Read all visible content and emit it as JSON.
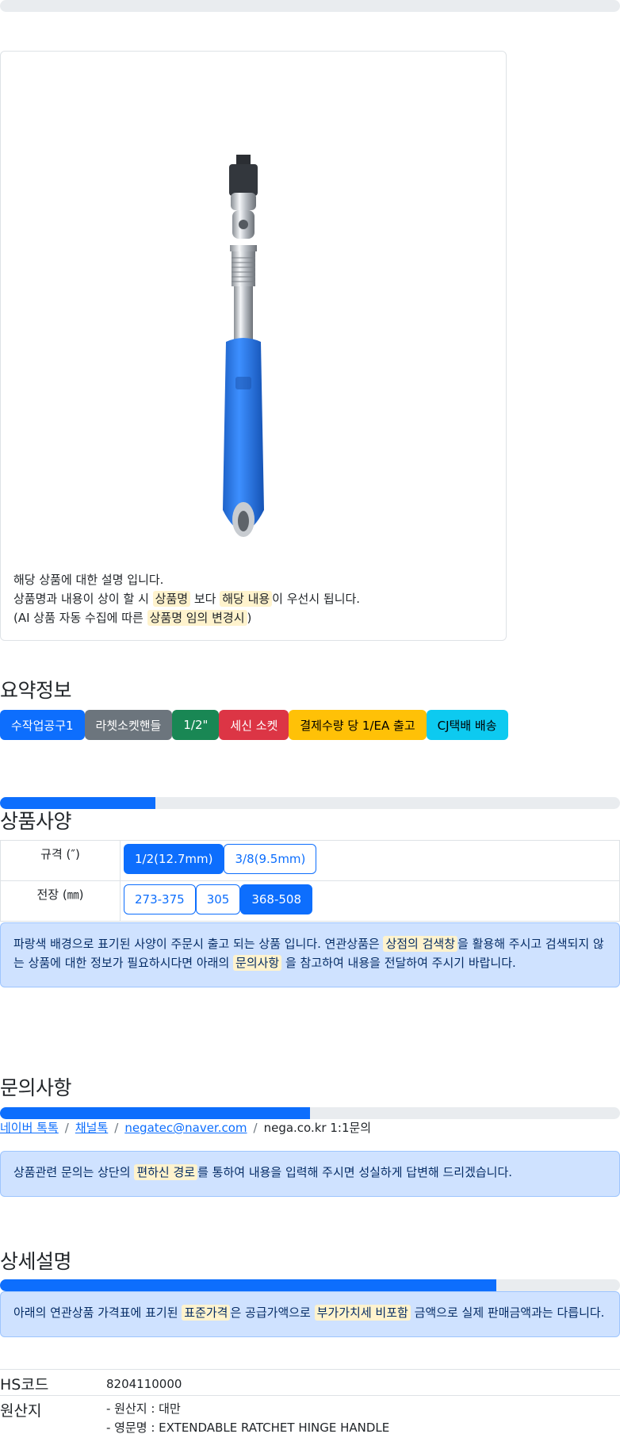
{
  "top_progress": {
    "value": 0
  },
  "product_card": {
    "image_icon": "ratchet-handle-product-photo",
    "description_lines": [
      {
        "parts": [
          {
            "text": "해당 상품에 대한 설명 입니다.",
            "hl": false
          }
        ]
      },
      {
        "parts": [
          {
            "text": "상품명과 내용이 상이 할 시 ",
            "hl": false
          },
          {
            "text": "상품명",
            "hl": true
          },
          {
            "text": " 보다 ",
            "hl": false
          },
          {
            "text": "해당 내용",
            "hl": true
          },
          {
            "text": "이 우선시 됩니다.",
            "hl": false
          }
        ]
      },
      {
        "parts": [
          {
            "text": "(AI 상품 자동 수집에 따른 ",
            "hl": false
          },
          {
            "text": "상품명 임의 변경시",
            "hl": true
          },
          {
            "text": ")",
            "hl": false
          }
        ]
      }
    ]
  },
  "summary": {
    "title": "요약정보",
    "badges": [
      {
        "label": "수작업공구1",
        "variant": "primary"
      },
      {
        "label": "라쳇소켓핸들",
        "variant": "secondary"
      },
      {
        "label": "1/2\"",
        "variant": "success"
      },
      {
        "label": "세신 소켓",
        "variant": "danger"
      },
      {
        "label": "결제수량 당 1/EA 출고",
        "variant": "warning"
      },
      {
        "label": "CJ택배 배송",
        "variant": "info"
      }
    ]
  },
  "specs": {
    "progress": 0.25,
    "title": "상품사양",
    "rows": [
      {
        "label": "규격 (″)",
        "options": [
          {
            "text": "1/2(12.7mm)",
            "active": true
          },
          {
            "text": "3/8(9.5mm)",
            "active": false
          }
        ]
      },
      {
        "label": "전장 (㎜)",
        "options": [
          {
            "text": "273-375",
            "active": false
          },
          {
            "text": "305",
            "active": false
          },
          {
            "text": "368-508",
            "active": true
          }
        ]
      }
    ],
    "notice_parts": [
      {
        "text": "파랑색 배경으로 표기된 사양이 주문시 출고 되는 상품 입니다. 연관상품은 ",
        "hl": false
      },
      {
        "text": "상점의 검색창",
        "hl": true
      },
      {
        "text": "을 활용해 주시고 검색되지 않는 상품에 대한 정보가 필요하시다면 아래의 ",
        "hl": false
      },
      {
        "text": "문의사항",
        "hl": true
      },
      {
        "text": " 을 참고하여 내용을 전달하여 주시기 바랍니다.",
        "hl": false
      }
    ]
  },
  "inquiry": {
    "title": "문의사항",
    "progress": 0.5,
    "links": [
      "네이버 톡톡",
      "채널톡",
      "negatec@naver.com"
    ],
    "plain": "nega.co.kr 1:1문의",
    "separator": "/",
    "notice_parts": [
      {
        "text": "상품관련 문의는 상단의 ",
        "hl": false
      },
      {
        "text": "편하신 경로",
        "hl": true
      },
      {
        "text": "를 통하여 내용을 입력해 주시면 성실하게 답변해 드리겠습니다.",
        "hl": false
      }
    ]
  },
  "detail": {
    "title": "상세설명",
    "progress": 0.8,
    "notice_parts": [
      {
        "text": "아래의 연관상품 가격표에 표기된 ",
        "hl": false
      },
      {
        "text": "표준가격",
        "hl": true
      },
      {
        "text": "은 공급가액으로 ",
        "hl": false
      },
      {
        "text": "부가가치세 비포함",
        "hl": true
      },
      {
        "text": " 금액으로 실제 판매금액과는 다릅니다.",
        "hl": false
      }
    ],
    "hs_label": "HS코드",
    "hs_value": "8204110000",
    "origin_label": "원산지",
    "origin_lines": [
      "- 원산지 : 대만",
      "- 영문명 : EXTENDABLE RATCHET HINGE HANDLE"
    ]
  }
}
